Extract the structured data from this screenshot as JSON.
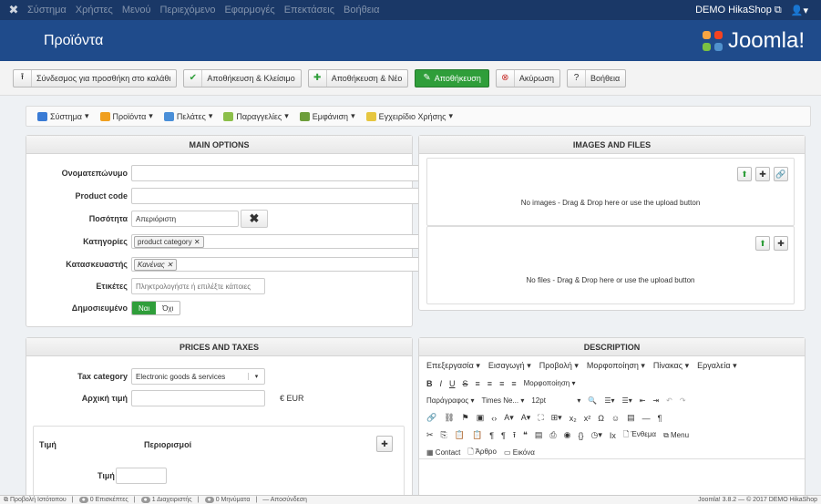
{
  "topbar": {
    "menu": [
      "Σύστημα",
      "Χρήστες",
      "Μενού",
      "Περιεχόμενο",
      "Εφαρμογές",
      "Επεκτάσεις",
      "Βοήθεια"
    ],
    "site": "DEMO HikaShop",
    "site_icon": "external-link-icon",
    "user_icon": "user-icon"
  },
  "header": {
    "title": "Προϊόντα",
    "brand": "Joomla!"
  },
  "toolbar": {
    "add_to_cart": "Σύνδεσμος για προσθήκη στο καλάθι",
    "save_close": "Αποθήκευση & Κλείσιμο",
    "save_new": "Αποθήκευση & Νέο",
    "save": "Αποθήκευση",
    "cancel": "Ακύρωση",
    "help": "Βοήθεια"
  },
  "hmenu": {
    "items": [
      "Σύστημα",
      "Προϊόντα",
      "Πελάτες",
      "Παραγγελίες",
      "Εμφάνιση",
      "Εγχειρίδιο Χρήσης"
    ]
  },
  "main_options": {
    "title": "MAIN OPTIONS",
    "name_label": "Ονοματεπώνυμο",
    "name_value": "",
    "code_label": "Product code",
    "code_value": "",
    "qty_label": "Ποσότητα",
    "qty_value": "Απεριόριστη",
    "cat_label": "Κατηγορίες",
    "cat_tag": "product category",
    "man_label": "Κατασκευαστής",
    "man_tag": "Κανένας",
    "tags_label": "Ετικέτες",
    "tags_placeholder": "Πληκτρολογήστε ή επιλέξτε κάποιες",
    "pub_label": "Δημοσιευμένο",
    "pub_yes": "Ναι",
    "pub_no": "Όχι"
  },
  "images": {
    "title": "IMAGES AND FILES",
    "no_images": "No images - Drag & Drop here or use the upload button",
    "no_files": "No files - Drag & Drop here or use the upload button"
  },
  "prices": {
    "title": "PRICES AND TAXES",
    "tax_label": "Tax category",
    "tax_value": "Electronic goods & services",
    "initial_label": "Αρχική τιμή",
    "initial_value": "",
    "currency": "€ EUR",
    "col_price": "Τιμή",
    "col_restr": "Περιορισμοί",
    "price_label": "Τιμή",
    "price_value": ""
  },
  "description": {
    "title": "DESCRIPTION",
    "menubar": [
      "Επεξεργασία",
      "Εισαγωγή",
      "Προβολή",
      "Μορφοποίηση",
      "Πίνακας",
      "Εργαλεία"
    ],
    "formats": "Μορφοποίηση",
    "paragraph": "Παράγραφος",
    "font": "Times Ne...",
    "size": "12pt",
    "insert": "Ένθεμα",
    "menu": "Menu",
    "contact": "Contact",
    "article": "Άρθρο",
    "image": "Εικόνα"
  },
  "statusbar": {
    "view_site": "Προβολή Ιστότοπου",
    "visitors": "0 Επισκέπτες",
    "admins": "1 Διαχειριστής",
    "messages": "0 Μηνύματα",
    "logout": "Αποσύνδεση",
    "version": "Joomla! 3.8.2 — © 2017 DEMO HikaShop"
  },
  "colors": {
    "topbar": "#1a3867",
    "header": "#1f4b8b",
    "save": "#2f9e3a"
  }
}
